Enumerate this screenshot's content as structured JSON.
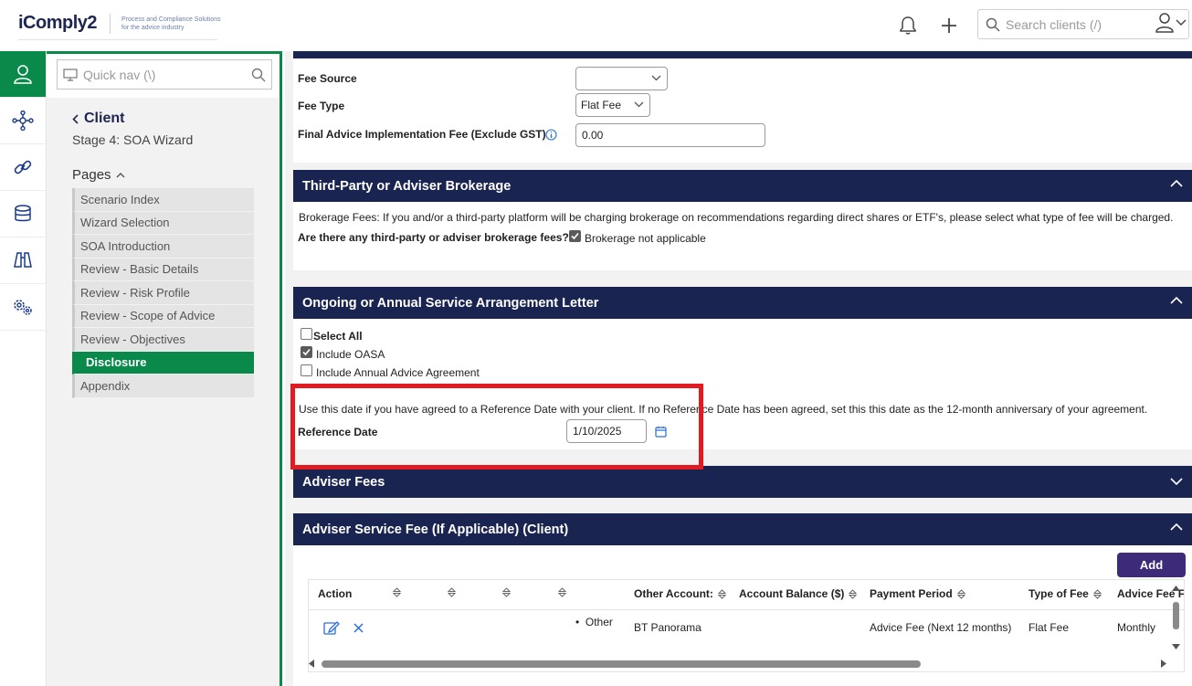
{
  "app": {
    "logo_text": "iComply2",
    "tagline_line1": "Process and Compliance Solutions",
    "tagline_line2": "for the advice industry"
  },
  "header": {
    "search_placeholder": "Search clients (/)"
  },
  "sidebar": {
    "quick_nav_placeholder": "Quick nav (\\)",
    "back_label": "Client",
    "stage": "Stage 4: SOA Wizard",
    "pages_heading": "Pages",
    "pages": [
      {
        "label": "Scenario Index"
      },
      {
        "label": "Wizard Selection"
      },
      {
        "label": "SOA Introduction"
      },
      {
        "label": "Review - Basic Details"
      },
      {
        "label": "Review - Risk Profile"
      },
      {
        "label": "Review - Scope of Advice"
      },
      {
        "label": "Review - Objectives"
      },
      {
        "label": "Disclosure",
        "active": true
      },
      {
        "label": "Appendix"
      }
    ]
  },
  "fees": {
    "fee_source_label": "Fee Source",
    "fee_source_value": "",
    "fee_type_label": "Fee Type",
    "fee_type_value": "Flat Fee",
    "final_fee_label": "Final Advice Implementation Fee (Exclude GST)",
    "final_fee_value": "0.00"
  },
  "brokerage": {
    "title": "Third-Party or Adviser Brokerage",
    "description": "Brokerage Fees: If you and/or a third-party platform will be charging brokerage on recommendations regarding direct shares or ETF's, please select what type of fee will be charged.",
    "question": "Are there any third-party or adviser brokerage fees?",
    "checkbox_label": "Brokerage not applicable",
    "checked": true
  },
  "ongoing": {
    "title": "Ongoing or Annual Service Arrangement Letter",
    "select_all": "Select All",
    "include_oasa": "Include OASA",
    "include_annual": "Include Annual Advice Agreement",
    "note": "Use this date if you have agreed to a Reference Date with your client. If no Reference Date has been agreed, set this this date as the 12-month anniversary of your agreement.",
    "reference_date_label": "Reference Date",
    "reference_date_value": "1/10/2025"
  },
  "adviser_fees": {
    "title": "Adviser Fees"
  },
  "service_fee": {
    "title": "Adviser Service Fee (If Applicable) (Client)",
    "add_label": "Add",
    "columns": [
      "Action",
      "",
      "",
      "",
      "",
      "Other Account:",
      "Account Balance ($)",
      "Payment Period",
      "Type of Fee",
      "Advice Fee F"
    ],
    "row": {
      "bullet": "Other",
      "other_account": "BT Panorama",
      "payment_period": "Advice Fee (Next 12 months)",
      "type_of_fee": "Flat Fee",
      "advice_fee_freq": "Monthly"
    }
  },
  "colors": {
    "navy": "#1a2450",
    "green": "#0a8a4a",
    "purple": "#3d2b7a",
    "highlight": "#e11b22"
  }
}
